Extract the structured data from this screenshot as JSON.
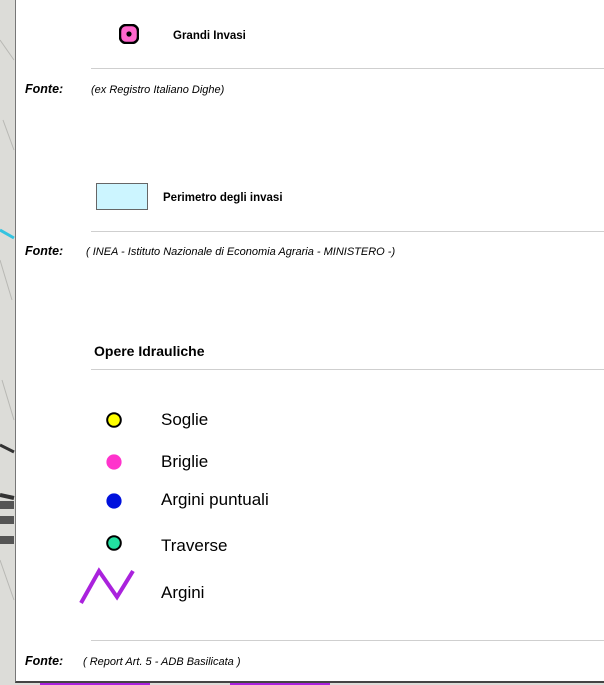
{
  "legend": {
    "grandi_invasi": {
      "label": "Grandi Invasi",
      "icon": "large-reservoir-icon",
      "fonte_label": "Fonte:",
      "fonte_text": "(ex Registro Italiano Dighe)"
    },
    "perimetro": {
      "label": "Perimetro degli invasi",
      "icon": "reservoir-perimeter-swatch",
      "fill_color": "#ccf5ff",
      "fonte_label": "Fonte:",
      "fonte_text": "( INEA - Istituto Nazionale  di Economia Agraria - MINISTERO -)"
    },
    "opere": {
      "title": "Opere  Idrauliche",
      "items": [
        {
          "label": "Soglie",
          "icon": "yellow-circle-icon",
          "color": "#ffff00"
        },
        {
          "label": "Briglie",
          "icon": "magenta-dot-icon",
          "color": "#ff33cc"
        },
        {
          "label": "Argini puntuali",
          "icon": "blue-dot-icon",
          "color": "#0011dd"
        },
        {
          "label": "Traverse",
          "icon": "green-circle-icon",
          "color": "#22e0a0"
        },
        {
          "label": "Argini",
          "icon": "purple-zigzag-icon",
          "color": "#aa22dd"
        }
      ],
      "fonte_label": "Fonte:",
      "fonte_text": "( Report Art. 5 - ADB Basilicata )"
    }
  }
}
